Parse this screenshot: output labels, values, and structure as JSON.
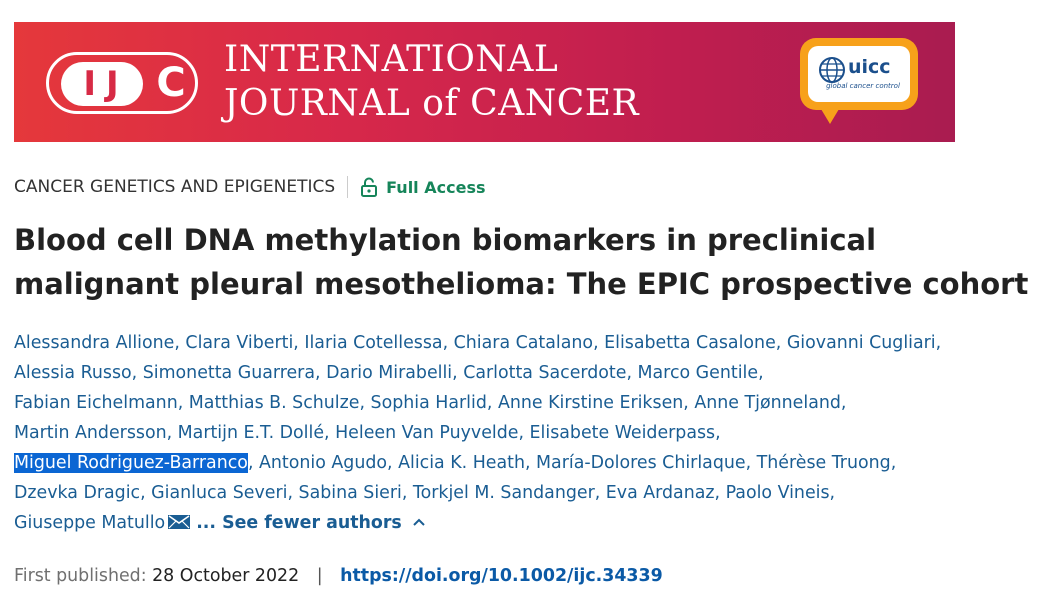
{
  "banner": {
    "logo_ij": "IJ",
    "logo_c": "C",
    "journal_line1": "INTERNATIONAL",
    "journal_line2": "JOURNAL of CANCER",
    "uicc_name": "uicc",
    "uicc_tagline": "global cancer control",
    "colors": {
      "gradient_start": "#e5383b",
      "gradient_end": "#a91c50",
      "uicc_orange": "#f7a11a",
      "uicc_blue": "#1b4f8c"
    }
  },
  "article": {
    "category": "CANCER GENETICS AND EPIGENETICS",
    "access_label": "Full Access",
    "access_icon": "open-lock-icon",
    "title": "Blood cell DNA methylation biomarkers in preclinical malignant pleural mesothelioma: The EPIC prospective cohort",
    "author_lines": [
      [
        "Alessandra Allione",
        "Clara Viberti",
        "Ilaria Cotellessa",
        "Chiara Catalano",
        "Elisabetta Casalone",
        "Giovanni Cugliari"
      ],
      [
        "Alessia Russo",
        "Simonetta Guarrera",
        "Dario Mirabelli",
        "Carlotta Sacerdote",
        "Marco Gentile"
      ],
      [
        "Fabian Eichelmann",
        "Matthias B. Schulze",
        "Sophia Harlid",
        "Anne Kirstine Eriksen",
        "Anne Tjønneland"
      ],
      [
        "Martin Andersson",
        "Martijn E.T. Dollé",
        "Heleen Van Puyvelde",
        "Elisabete Weiderpass"
      ],
      [
        "Miguel Rodriguez-Barranco",
        "Antonio Agudo",
        "Alicia K. Heath",
        "María-Dolores Chirlaque",
        "Thérèse Truong"
      ],
      [
        "Dzevka Dragic",
        "Gianluca Severi",
        "Sabina Sieri",
        "Torkjel M. Sandanger",
        "Eva Ardanaz",
        "Paolo Vineis"
      ],
      [
        "Giuseppe Matullo"
      ]
    ],
    "separator": ",",
    "selected_author": "Miguel Rodriguez-Barranco",
    "corresponding_icon": "envelope-icon",
    "see_fewer": "... See fewer authors",
    "see_fewer_icon": "chevron-up-icon",
    "first_published_label": "First published:",
    "first_published_date": "28 October 2022",
    "pipe": "|",
    "doi": "https://doi.org/10.1002/ijc.34339"
  }
}
